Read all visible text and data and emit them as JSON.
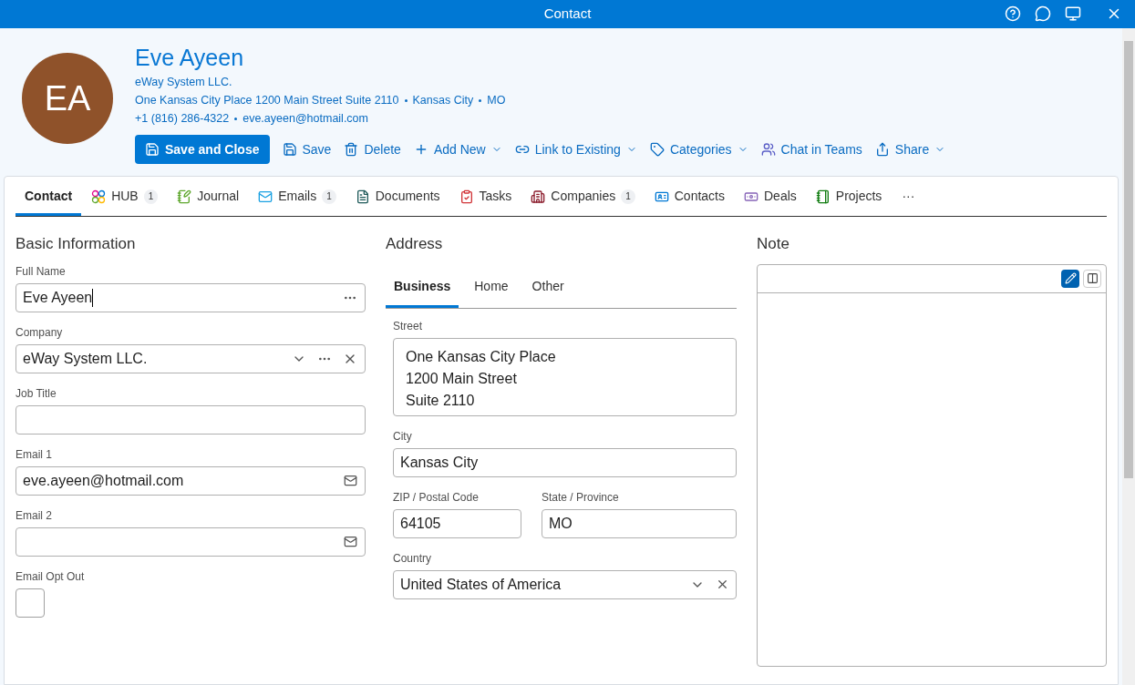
{
  "window": {
    "title": "Contact"
  },
  "contact": {
    "initials": "EA",
    "name": "Eve Ayeen",
    "company": "eWay System LLC.",
    "address_parts": [
      "One Kansas City Place 1200 Main Street Suite 2110",
      "Kansas City",
      "MO"
    ],
    "contact_parts": [
      "+1 (816) 286-4322",
      "eve.ayeen@hotmail.com"
    ]
  },
  "toolbar": [
    {
      "label": "Save and Close",
      "kind": "primary",
      "dropdown": false
    },
    {
      "label": "Save",
      "kind": "plain",
      "dropdown": false
    },
    {
      "label": "Delete",
      "kind": "plain",
      "dropdown": false
    },
    {
      "label": "Add New",
      "kind": "plain",
      "dropdown": true
    },
    {
      "label": "Link to Existing",
      "kind": "plain",
      "dropdown": true
    },
    {
      "label": "Categories",
      "kind": "plain",
      "dropdown": true
    },
    {
      "label": "Chat in Teams",
      "kind": "plain",
      "dropdown": false
    },
    {
      "label": "Share",
      "kind": "plain",
      "dropdown": true
    }
  ],
  "tabs": [
    {
      "label": "Contact",
      "selected": true
    },
    {
      "label": "HUB",
      "selected": false,
      "count": "1"
    },
    {
      "label": "Journal",
      "selected": false
    },
    {
      "label": "Emails",
      "selected": false,
      "count": "1"
    },
    {
      "label": "Documents",
      "selected": false
    },
    {
      "label": "Tasks",
      "selected": false
    },
    {
      "label": "Companies",
      "selected": false,
      "count": "1"
    },
    {
      "label": "Contacts",
      "selected": false
    },
    {
      "label": "Deals",
      "selected": false
    },
    {
      "label": "Projects",
      "selected": false
    }
  ],
  "tabs_more": "···",
  "basic": {
    "title": "Basic Information",
    "fields": [
      {
        "label": "Full Name",
        "kind": "name",
        "value": "Eve Ayeen"
      },
      {
        "label": "Company",
        "kind": "lookup",
        "value": "eWay System LLC."
      },
      {
        "label": "Job Title",
        "kind": "text"
      },
      {
        "label": "Email 1",
        "kind": "email",
        "value": "eve.ayeen@hotmail.com"
      },
      {
        "label": "Email 2",
        "kind": "email"
      },
      {
        "label": "Email Opt Out",
        "kind": "checkbox",
        "checked": false
      }
    ]
  },
  "address": {
    "title": "Address",
    "tabs": [
      {
        "label": "Business",
        "selected": true
      },
      {
        "label": "Home",
        "selected": false
      },
      {
        "label": "Other",
        "selected": false
      }
    ],
    "street": {
      "label": "Street",
      "lines": [
        "One Kansas City Place",
        "1200 Main Street",
        "Suite 2110"
      ]
    },
    "city": {
      "label": "City",
      "value": "Kansas City"
    },
    "zip": {
      "label": "ZIP / Postal Code",
      "value": "64105"
    },
    "state": {
      "label": "State / Province",
      "value": "MO"
    },
    "country": {
      "label": "Country",
      "value": "United States of America"
    }
  },
  "note": {
    "title": "Note",
    "modes": [
      {
        "selected": true
      },
      {
        "selected": false
      }
    ]
  }
}
